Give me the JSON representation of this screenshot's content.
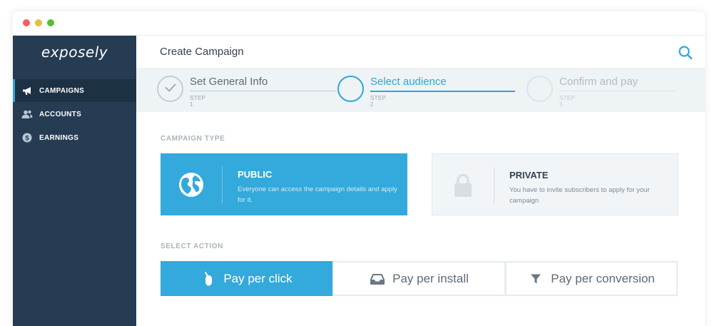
{
  "app": {
    "logo_text": "exposely"
  },
  "sidebar": {
    "items": [
      {
        "label": "CAMPAIGNS",
        "icon": "megaphone-icon",
        "active": true
      },
      {
        "label": "ACCOUNTS",
        "icon": "users-icon",
        "active": false
      },
      {
        "label": "EARNINGS",
        "icon": "dollar-coin-icon",
        "active": false
      }
    ]
  },
  "header": {
    "title": "Create Campaign",
    "search_icon": "search-icon"
  },
  "stepper": {
    "steps": [
      {
        "title": "Set General Info",
        "sub": "STEP 1",
        "state": "done"
      },
      {
        "title": "Select audience",
        "sub": "STEP 2",
        "state": "current"
      },
      {
        "title": "Confirm and pay",
        "sub": "STEP 3",
        "state": "future"
      }
    ]
  },
  "campaign_type": {
    "label": "CAMPAIGN TYPE",
    "options": [
      {
        "title": "PUBLIC",
        "desc": "Everyone can access the campaign details and apply for it.",
        "icon": "globe-icon",
        "selected": true
      },
      {
        "title": "PRIVATE",
        "desc": "You have to invite subscribers to apply for your campaign",
        "icon": "lock-icon",
        "selected": false
      }
    ]
  },
  "select_action": {
    "label": "SELECT ACTION",
    "options": [
      {
        "label": "Pay per click",
        "icon": "mouse-icon",
        "selected": true
      },
      {
        "label": "Pay per install",
        "icon": "inbox-tray-icon",
        "selected": false
      },
      {
        "label": "Pay per conversion",
        "icon": "funnel-icon",
        "selected": false
      }
    ]
  },
  "colors": {
    "accent": "#34a9db",
    "sidebar_bg": "#253c53",
    "sidebar_active_bg": "#1d3145",
    "stepper_bg": "#eef3f6"
  }
}
